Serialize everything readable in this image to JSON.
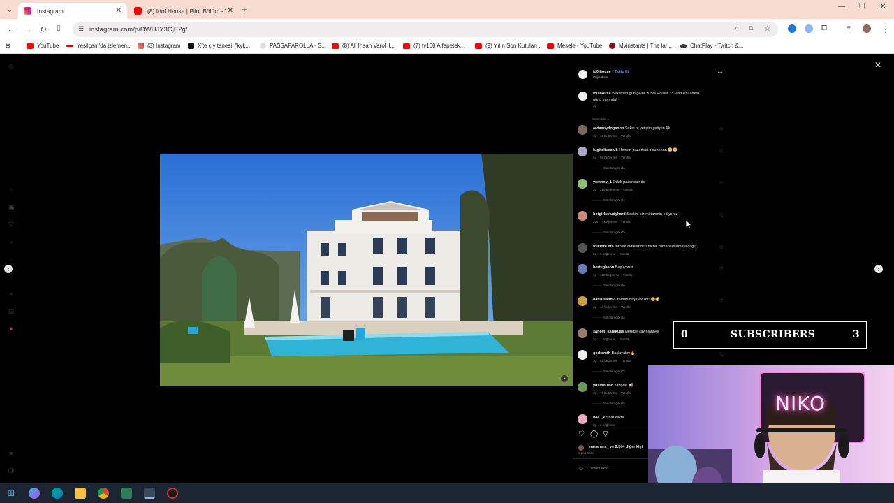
{
  "browser": {
    "tabs": [
      {
        "title": "Instagram",
        "active": true
      },
      {
        "title": "(8) Idol House | Pilot Bölüm - Yo",
        "active": false
      }
    ],
    "url": "instagram.com/p/DWHJY3CjE2g/",
    "bookmarks": [
      "YouTube",
      "Yeşilçam'da izlemen...",
      "(3) Instagram",
      "X'te çiy tanesi: \"kyk...",
      "PASSAPAROLLA - S...",
      "(8) Ali İhsan Varol il...",
      "(7) tv100 Alfapetek...",
      "(9) Yılın Son Kutuları...",
      "Mesele - YouTube",
      "Myinstants | The lar...",
      "ChatPlay - Twitch &..."
    ]
  },
  "post": {
    "username": "id0lhouse",
    "follow_label": "Takip Et",
    "audio": "Orijinal ses",
    "caption_user": "id0lhouse",
    "caption_text": "Beklenen gün geldi. ⚡Idol House 23 Mart Pazartesi",
    "caption_text2": "günü yayında!",
    "caption_time": "3g",
    "sort_label": "Senin için ⌄",
    "likes_text": "nanahera_ ve 2.864 diğer kişi",
    "post_time": "3 gün önce",
    "comment_placeholder": "Yorum ekle..."
  },
  "comments": [
    {
      "user": "ardasoydogannn",
      "text": "Sakin ol yetiştin yetiştin 😅",
      "time": "3g",
      "likes": "42 beğenme",
      "reply": "Yanıtla",
      "replies": "",
      "avatar": "#7a6a60"
    },
    {
      "user": "tugitoliveclub",
      "text": "Hemen pazartesi olsunnnnn 🥺🥺",
      "time": "3g",
      "likes": "86 beğenme",
      "reply": "Yanıtla",
      "replies": "Yanıtları gör (1)",
      "avatar": "#b0a8c8"
    },
    {
      "user": "ysmnny_1",
      "text": "Odak pazartesinde",
      "time": "3g",
      "likes": "210 beğenme",
      "reply": "Yanıtla",
      "replies": "Yanıtları gör (1)",
      "avatar": "#8fc27a"
    },
    {
      "user": "hotgirlsstudyhard",
      "text": "Saatini biz mi tahmin ediyoruz",
      "time": "22s",
      "likes": "7 beğenme",
      "reply": "Yanıtla",
      "replies": "Yanıtları gör (1)",
      "avatar": "#c98a7a"
    },
    {
      "user": "folklore.era",
      "text": "torpille aldıklarınızı hiçbir zaman unutmayacağız",
      "time": "2g",
      "likes": "5 beğenme",
      "reply": "Yanıtla",
      "replies": "",
      "avatar": "#555"
    },
    {
      "user": "bertugheon",
      "text": "Başlıyoruz..",
      "time": "3g",
      "likes": "188 beğenme",
      "reply": "Yanıtla",
      "replies": "Yanıtları gör (5)",
      "avatar": "#6a7ab8"
    },
    {
      "user": "batuusann",
      "text": "o zaman başlıyoruzzz🥺🥺",
      "time": "3g",
      "likes": "16 beğenme",
      "reply": "Yanıtla",
      "replies": "Yanıtları gör (1)",
      "avatar": "#c8a040"
    },
    {
      "user": "sanem_karakuss",
      "text": "Nerede yayınlanıyor",
      "time": "2g",
      "likes": "1 beğenme",
      "reply": "Yanıtla",
      "replies": "",
      "avatar": "#9a7a6a"
    },
    {
      "user": "gorkemth",
      "text": "Başlayalım🔥",
      "time": "3g",
      "likes": "61 beğenme",
      "reply": "Yanıtla",
      "replies": "Yanıtları gör (2)",
      "avatar": "#eee"
    },
    {
      "user": "yusifmusic",
      "text": "Yarışdır 📢",
      "time": "3g",
      "likes": "79 beğenme",
      "reply": "Yanıtla",
      "replies": "Yanıtları gör (1)",
      "avatar": "#6a9a5a"
    },
    {
      "user": "b4a._k",
      "text": "Saat kaçta",
      "time": "3g",
      "likes": "2 beğenme",
      "reply": "",
      "replies": "",
      "avatar": "#f0a8c0"
    }
  ],
  "overlay": {
    "sub_left": "0",
    "sub_label": "SUBSCRIBERS",
    "sub_right": "3",
    "neon_sign": "NIKO"
  }
}
